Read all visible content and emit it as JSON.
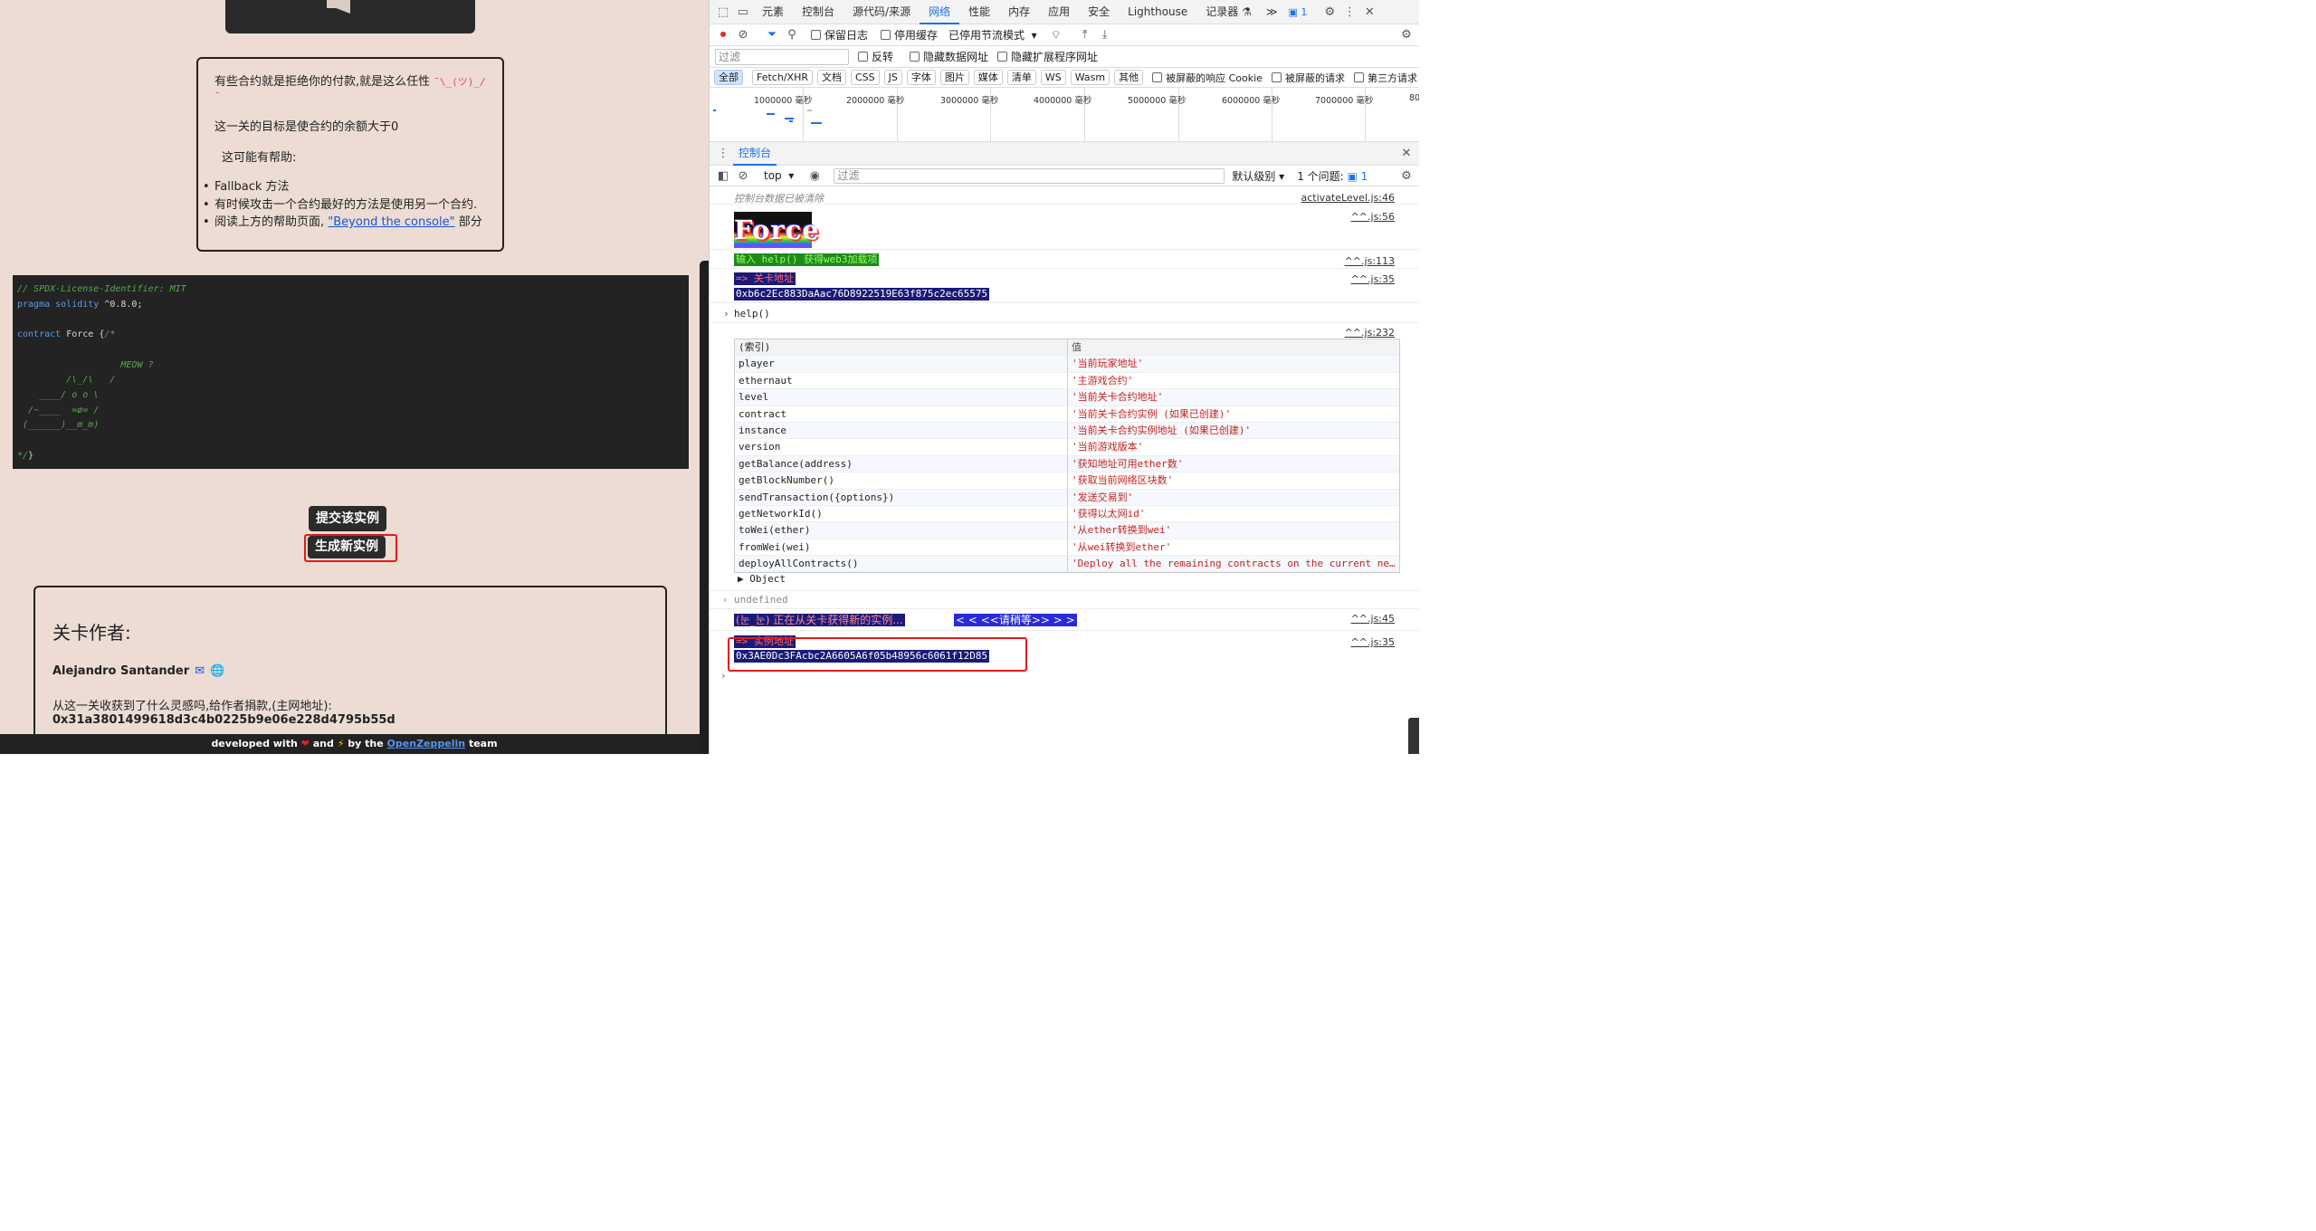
{
  "page": {
    "description": {
      "line1": "有些合约就是拒绝你的付款,就是这么任性",
      "shrug": "¯\\_(ツ)_/¯",
      "line2": "这一关的目标是使合约的余额大于0",
      "line3": "这可能有帮助:",
      "bullets": [
        "Fallback 方法",
        "有时候攻击一个合约最好的方法是使用另一个合约."
      ],
      "bullet3_prefix": "阅读上方的帮助页面,",
      "bullet3_link": "\"Beyond the console\"",
      "bullet3_suffix": "部分"
    },
    "code": {
      "line1": "// SPDX-License-Identifier: MIT",
      "pragma": "pragma solidity",
      "version": " ^0.8.0;",
      "contract_kw": "contract",
      "contract_name": " Force {",
      "art_start": "/*",
      "art": "\n\n                   MEOW ?\n         /\\_/\\   /\n    ____/ o o \\\n  /~____  =ø= /\n (______)__m_m)\n\n",
      "art_end": "*/",
      "close": "}"
    },
    "buttons": {
      "submit": "提交该实例",
      "new_instance": "生成新实例"
    },
    "author": {
      "heading": "关卡作者:",
      "name": "Alejandro Santander",
      "donate_text": "从这一关收获到了什么灵感吗,给作者捐款,(主网地址): ",
      "donate_addr": "0x31a3801499618d3c4b0225b9e06e228d4795b55d"
    },
    "footer": {
      "prefix": "developed with",
      "and": "and",
      "by": "by the",
      "link": "OpenZeppelin",
      "suffix": "team"
    }
  },
  "devtools": {
    "tabs": [
      "元素",
      "控制台",
      "源代码/来源",
      "网络",
      "性能",
      "内存",
      "应用",
      "安全",
      "Lighthouse",
      "记录器 ⚗",
      "≫"
    ],
    "active_tab": "网络",
    "issues_count": "1",
    "net_options": {
      "preserve_log": "保留日志",
      "disable_cache": "停用缓存",
      "throttle": "已停用节流模式"
    },
    "filter": {
      "placeholder": "过滤",
      "invert": "反转",
      "hide_data": "隐藏数据网址",
      "hide_ext": "隐藏扩展程序网址"
    },
    "types": [
      "全部",
      "Fetch/XHR",
      "文档",
      "CSS",
      "JS",
      "字体",
      "图片",
      "媒体",
      "清单",
      "WS",
      "Wasm",
      "其他"
    ],
    "types_checks": {
      "blocked_cookies": "被屏蔽的响应 Cookie",
      "blocked_requests": "被屏蔽的请求",
      "third_party": "第三方请求"
    },
    "timeline_labels": [
      "1000000 毫秒",
      "2000000 毫秒",
      "3000000 毫秒",
      "4000000 毫秒",
      "5000000 毫秒",
      "6000000 毫秒",
      "7000000 毫秒",
      "80"
    ],
    "console_tab": "控制台",
    "console_bar": {
      "context": "top",
      "filter": "过滤",
      "level": "默认级别",
      "issues": "1 个问题:",
      "issues_count": "1"
    },
    "messages": {
      "cleared": "控制台数据已被清除",
      "cleared_src": "activateLevel.js:46",
      "force_title": "Force",
      "force_src": "^^.js:56",
      "help_hint": "输入 help() 获得web3加载项",
      "help_hint_src": "^^.js:113",
      "level_label": "=> 关卡地址",
      "level_addr": "0xb6c2Ec883DaAac76D8922519E63f875c2ec65575",
      "level_src": "^^.js:35",
      "help_cmd": "help()",
      "table_src": "^^.js:232",
      "table_headers": [
        "(索引)",
        "值"
      ],
      "table_rows": [
        [
          "player",
          "'当前玩家地址'"
        ],
        [
          "ethernaut",
          "'主游戏合约'"
        ],
        [
          "level",
          "'当前关卡合约地址'"
        ],
        [
          "contract",
          "'当前关卡合约实例 (如果已创建)'"
        ],
        [
          "instance",
          "'当前关卡合约实例地址 (如果已创建)'"
        ],
        [
          "version",
          "'当前游戏版本'"
        ],
        [
          "getBalance(address)",
          "'获知地址可用ether数'"
        ],
        [
          "getBlockNumber()",
          "'获取当前网络区块数'"
        ],
        [
          "sendTransaction({options})",
          "'发送交易到'"
        ],
        [
          "getNetworkId()",
          "'获得以太网id'"
        ],
        [
          "toWei(ether)",
          "'从ether转换到wei'"
        ],
        [
          "fromWei(wei)",
          "'从wei转换到ether'"
        ],
        [
          "deployAllContracts()",
          "'Deploy all the remaining contracts on the current network.'"
        ]
      ],
      "object_label": "▶ Object",
      "undefined": "undefined",
      "loading": "(눈_눈) 正在从关卡获得新的实例...",
      "loading_wait": " < < <<请稍等>> > > ",
      "loading_src": "^^.js:45",
      "instance_label": "=> 实例地址",
      "instance_addr": "0x3AE0Dc3FAcbc2A6605A6f05b48956c6061f12D85",
      "instance_src": "^^.js:35"
    }
  },
  "colors": {
    "accent": "#1a73e8",
    "highlight_red": "#e61919",
    "page_bg": "#ecdcd3"
  }
}
